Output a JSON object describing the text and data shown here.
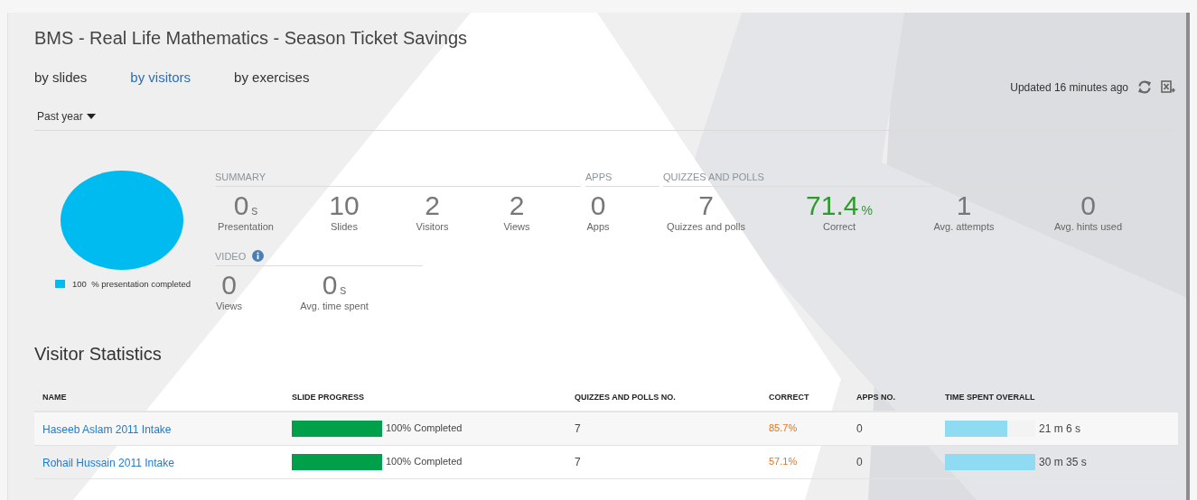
{
  "title": "BMS - Real Life Mathematics - Season Ticket Savings",
  "tabs": [
    {
      "label": "by slides",
      "selected": false
    },
    {
      "label": "by visitors",
      "selected": true
    },
    {
      "label": "by exercises",
      "selected": false
    }
  ],
  "period": {
    "value": "Past year"
  },
  "updated": "Updated 16 minutes ago",
  "completion": {
    "level": 1,
    "value": "100",
    "label": "% presentation completed",
    "color": "#00bbf0"
  },
  "stat_groups": [
    {
      "heading": "SUMMARY",
      "info": false,
      "stats": [
        {
          "value": "0",
          "unit": "s",
          "label": "Presentation",
          "accent": false
        },
        {
          "value": "10",
          "label": "Slides",
          "accent": false
        },
        {
          "value": "2",
          "label": "Visitors",
          "accent": false
        },
        {
          "value": "2",
          "label": "Views",
          "accent": false
        }
      ]
    },
    {
      "heading": "APPS",
      "info": false,
      "stats": [
        {
          "value": "0",
          "label": "Apps",
          "accent": false
        }
      ]
    },
    {
      "heading": "QUIZZES AND POLLS",
      "info": false,
      "stats": [
        {
          "value": "7",
          "label": "Quizzes and polls",
          "accent": false
        },
        {
          "value": "71.4",
          "unit": "%",
          "label": "Correct",
          "accent": true
        },
        {
          "value": "1",
          "label": "Avg. attempts",
          "accent": false
        },
        {
          "value": "0",
          "label": "Avg. hints used",
          "accent": false
        }
      ]
    },
    {
      "heading": "VIDEO",
      "info": true,
      "stats": [
        {
          "value": "0",
          "label": "Views",
          "accent": false
        },
        {
          "value": "0",
          "unit": "s",
          "label": "Avg. time spent",
          "accent": false
        }
      ]
    }
  ],
  "visitor_statistics": {
    "title": "Visitor Statistics",
    "columns": [
      "NAME",
      "SLIDE PROGRESS",
      "QUIZZES AND POLLS NO.",
      "CORRECT",
      "APPS NO.",
      "TIME SPENT OVERALL"
    ],
    "rows": [
      {
        "name": "Haseeb Aslam 2011 Intake",
        "progress": {
          "level": 1,
          "text": "100% Completed"
        },
        "quizzes": "7",
        "correct": "85.7%",
        "apps": "0",
        "time": {
          "level": 0.69,
          "text": "21 m 6 s"
        }
      },
      {
        "name": "Rohail Hussain 2011 Intake",
        "progress": {
          "level": 1,
          "text": "100% Completed"
        },
        "quizzes": "7",
        "correct": "57.1%",
        "apps": "0",
        "time": {
          "level": 1,
          "text": "30 m 35 s"
        }
      }
    ]
  }
}
